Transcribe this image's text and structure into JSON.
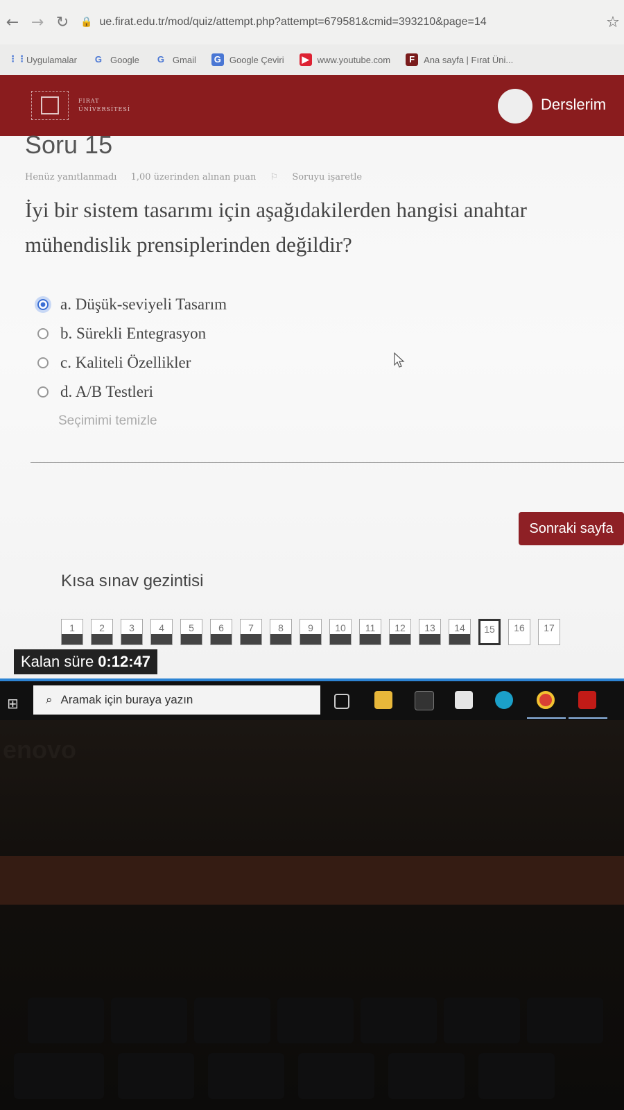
{
  "browser": {
    "url": "ue.firat.edu.tr/mod/quiz/attempt.php?attempt=679581&cmid=393210&page=14",
    "bookmarks": [
      "Uygulamalar",
      "Google",
      "Gmail",
      "Google Çeviri",
      "www.youtube.com",
      "Ana sayfa | Fırat Üni..."
    ]
  },
  "header": {
    "logo_text_line1": "FIRAT",
    "logo_text_line2": "ÜNİVERSİTESİ",
    "nav_label": "Derslerim"
  },
  "question": {
    "title": "Soru 15",
    "status": "Henüz yanıtlanmadı",
    "grade": "1,00 üzerinden alınan puan",
    "flag_label": "Soruyu işaretle",
    "text": "İyi bir sistem tasarımı için aşağıdakilerden hangisi anahtar mühendislik prensiplerinden değildir?",
    "answers": [
      {
        "label": "a. Düşük-seviyeli Tasarım",
        "selected": true
      },
      {
        "label": "b. Sürekli Entegrasyon",
        "selected": false
      },
      {
        "label": "c. Kaliteli Özellikler",
        "selected": false
      },
      {
        "label": "d. A/B Testleri",
        "selected": false
      }
    ],
    "clear_label": "Seçimimi temizle"
  },
  "next_button": "Sonraki sayfa",
  "quiz_nav": {
    "title": "Kısa sınav gezintisi",
    "questions": [
      "1",
      "2",
      "3",
      "4",
      "5",
      "6",
      "7",
      "8",
      "9",
      "10",
      "11",
      "12",
      "13",
      "14",
      "15",
      "16",
      "17"
    ],
    "answered_count": 14,
    "current": "15"
  },
  "timer": {
    "label": "Kalan süre",
    "value": "0:12:47"
  },
  "taskbar": {
    "search_placeholder": "Aramak için buraya yazın"
  },
  "laptop_brand": "enovo"
}
